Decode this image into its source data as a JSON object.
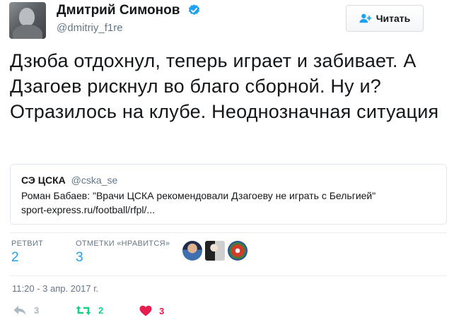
{
  "author": {
    "name": "Дмитрий Симонов",
    "handle": "@dmitriy_f1re",
    "verified": true
  },
  "follow_button": {
    "label": "Читать",
    "icon": "add-person-icon"
  },
  "tweet": {
    "text": "Дзюба отдохнул, теперь играет и забивает. А Дзагоев рискнул во благо сборной. Ну и? Отразилось на клубе. Неоднозначная ситуация"
  },
  "quoted_tweet": {
    "name": "СЭ ЦСКА",
    "handle": "@cska_se",
    "text": "Роман Бабаев: \"Врачи ЦСКА рекомендовали Дзагоеву не играть с Бельгией\"",
    "link": "sport-express.ru/football/rfpl/..."
  },
  "stats": {
    "retweets_label": "РЕТВИТ",
    "retweets_value": "2",
    "likes_label": "ОТМЕТКИ «НРАВИТСЯ»",
    "likes_value": "3"
  },
  "likers": [
    "avatar-1",
    "avatar-2",
    "avatar-3"
  ],
  "timestamp": "11:20 - 3 апр. 2017 г.",
  "actions": {
    "reply_count": "3",
    "retweet_count": "2",
    "like_count": "3"
  },
  "colors": {
    "accent": "#1da1f2",
    "retweet": "#19cf86",
    "like": "#e81c4f",
    "muted": "#657786",
    "verified": "#1da1f2"
  }
}
